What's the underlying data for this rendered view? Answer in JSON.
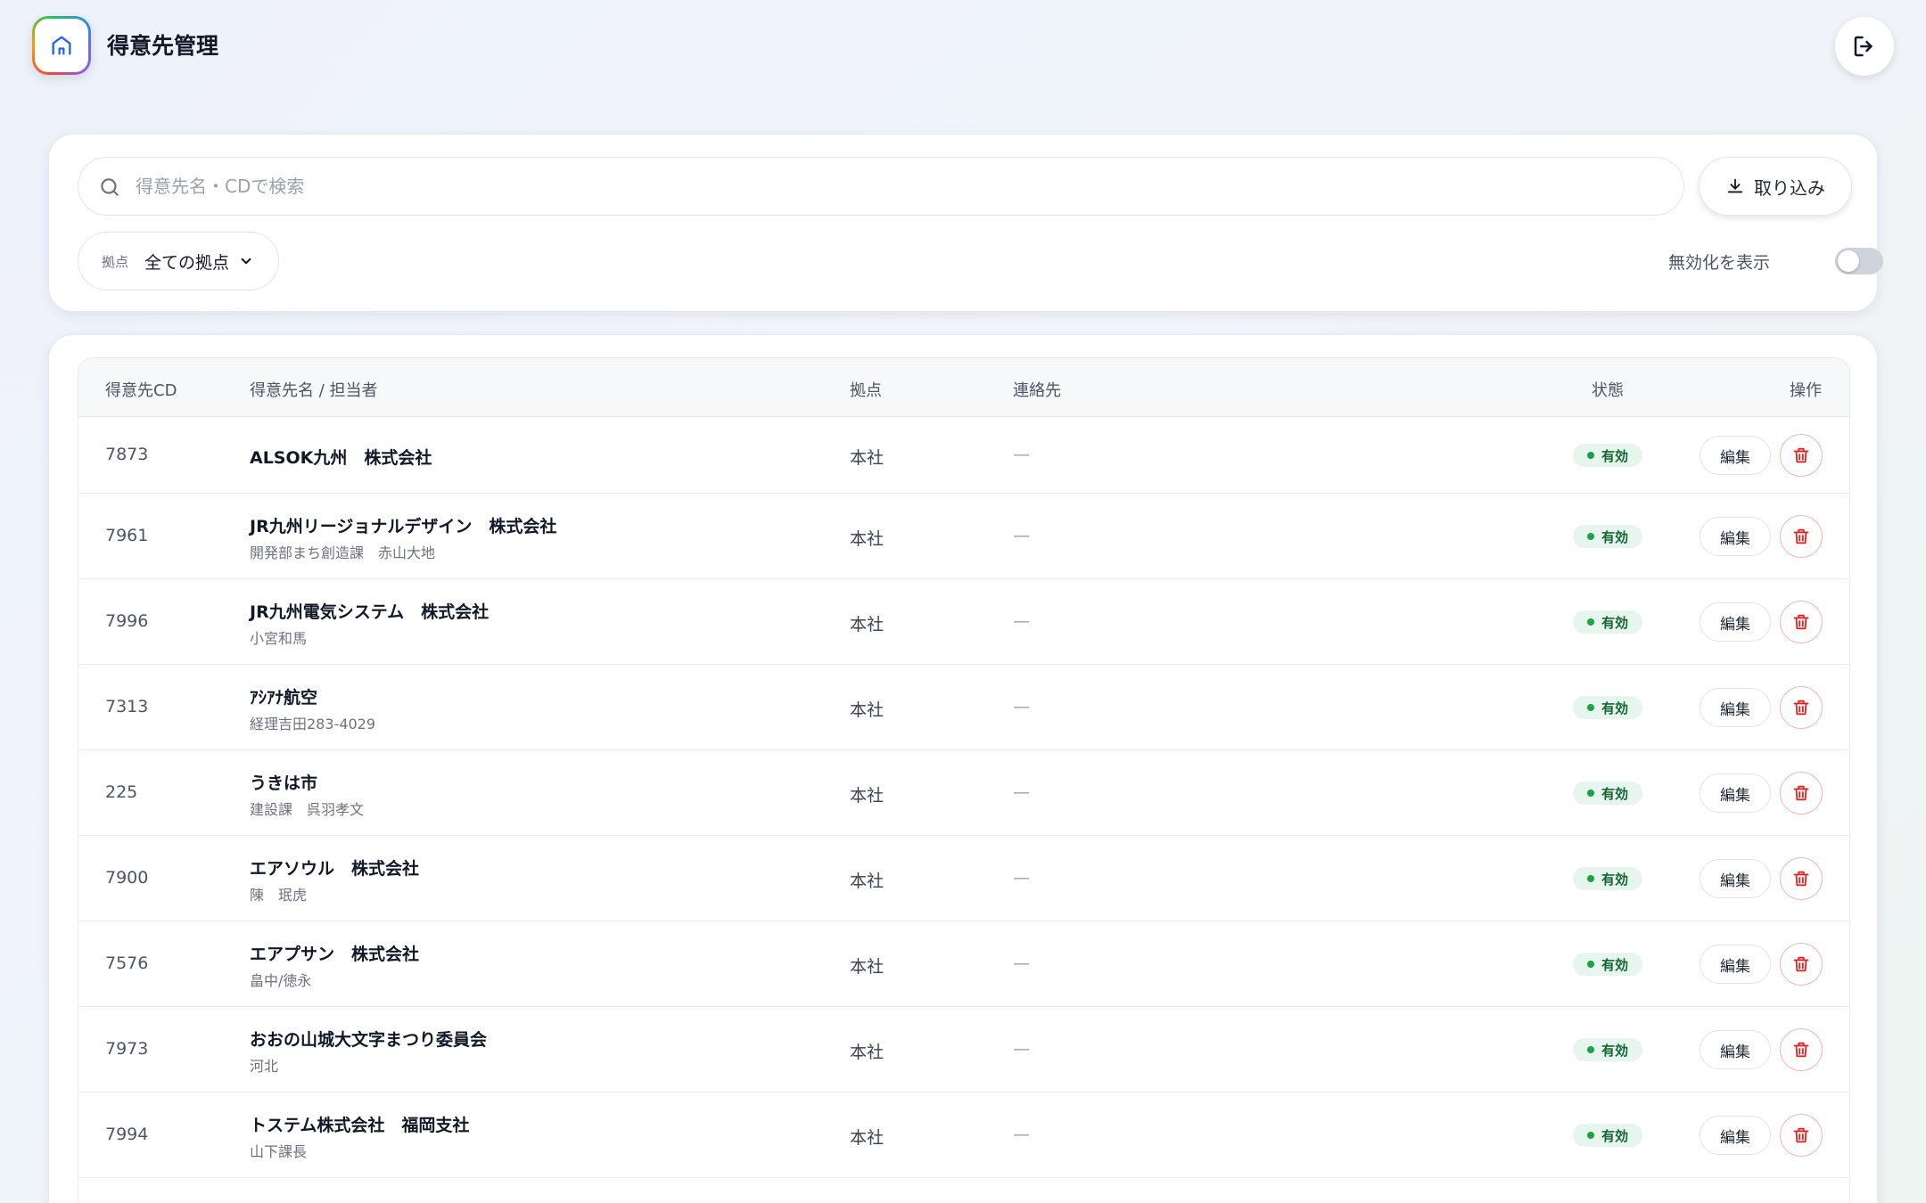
{
  "header": {
    "title": "得意先管理",
    "logo_icon": "home-icon",
    "logout_icon": "logout-icon"
  },
  "filters": {
    "search_placeholder": "得意先名・CDで検索",
    "search_value": "",
    "import_label": "取り込み",
    "location_label": "拠点",
    "location_value": "全ての拠点",
    "show_disabled_label": "無効化を表示",
    "show_disabled": false
  },
  "table": {
    "columns": [
      "得意先CD",
      "得意先名 / 担当者",
      "拠点",
      "連絡先",
      "状態",
      "操作"
    ],
    "edit_label": "編集",
    "rows": [
      {
        "cd": "7873",
        "name": "ALSOK九州　株式会社",
        "person": "",
        "location": "本社",
        "contact": "—",
        "status": "有効"
      },
      {
        "cd": "7961",
        "name": "JR九州リージョナルデザイン　株式会社",
        "person": "開発部まち創造課　赤山大地",
        "location": "本社",
        "contact": "—",
        "status": "有効"
      },
      {
        "cd": "7996",
        "name": "JR九州電気システム　株式会社",
        "person": "小宮和馬",
        "location": "本社",
        "contact": "—",
        "status": "有効"
      },
      {
        "cd": "7313",
        "name": "ｱｼｱﾅ航空",
        "person": "経理吉田283-4029",
        "location": "本社",
        "contact": "—",
        "status": "有効"
      },
      {
        "cd": "225",
        "name": "うきは市",
        "person": "建設課　呉羽孝文",
        "location": "本社",
        "contact": "—",
        "status": "有効"
      },
      {
        "cd": "7900",
        "name": "エアソウル　株式会社",
        "person": "陳　珉虎",
        "location": "本社",
        "contact": "—",
        "status": "有効"
      },
      {
        "cd": "7576",
        "name": "エアプサン　株式会社",
        "person": "畠中/徳永",
        "location": "本社",
        "contact": "—",
        "status": "有効"
      },
      {
        "cd": "7973",
        "name": "おおの山城大文字まつり委員会",
        "person": "河北",
        "location": "本社",
        "contact": "—",
        "status": "有効"
      },
      {
        "cd": "7994",
        "name": "トステム株式会社　福岡支社",
        "person": "山下課長",
        "location": "本社",
        "contact": "—",
        "status": "有効"
      }
    ]
  },
  "colors": {
    "accent": "#2563eb",
    "active_badge_bg": "#e7f6ec",
    "active_badge_text": "#166534",
    "delete_red": "#dc2626"
  }
}
